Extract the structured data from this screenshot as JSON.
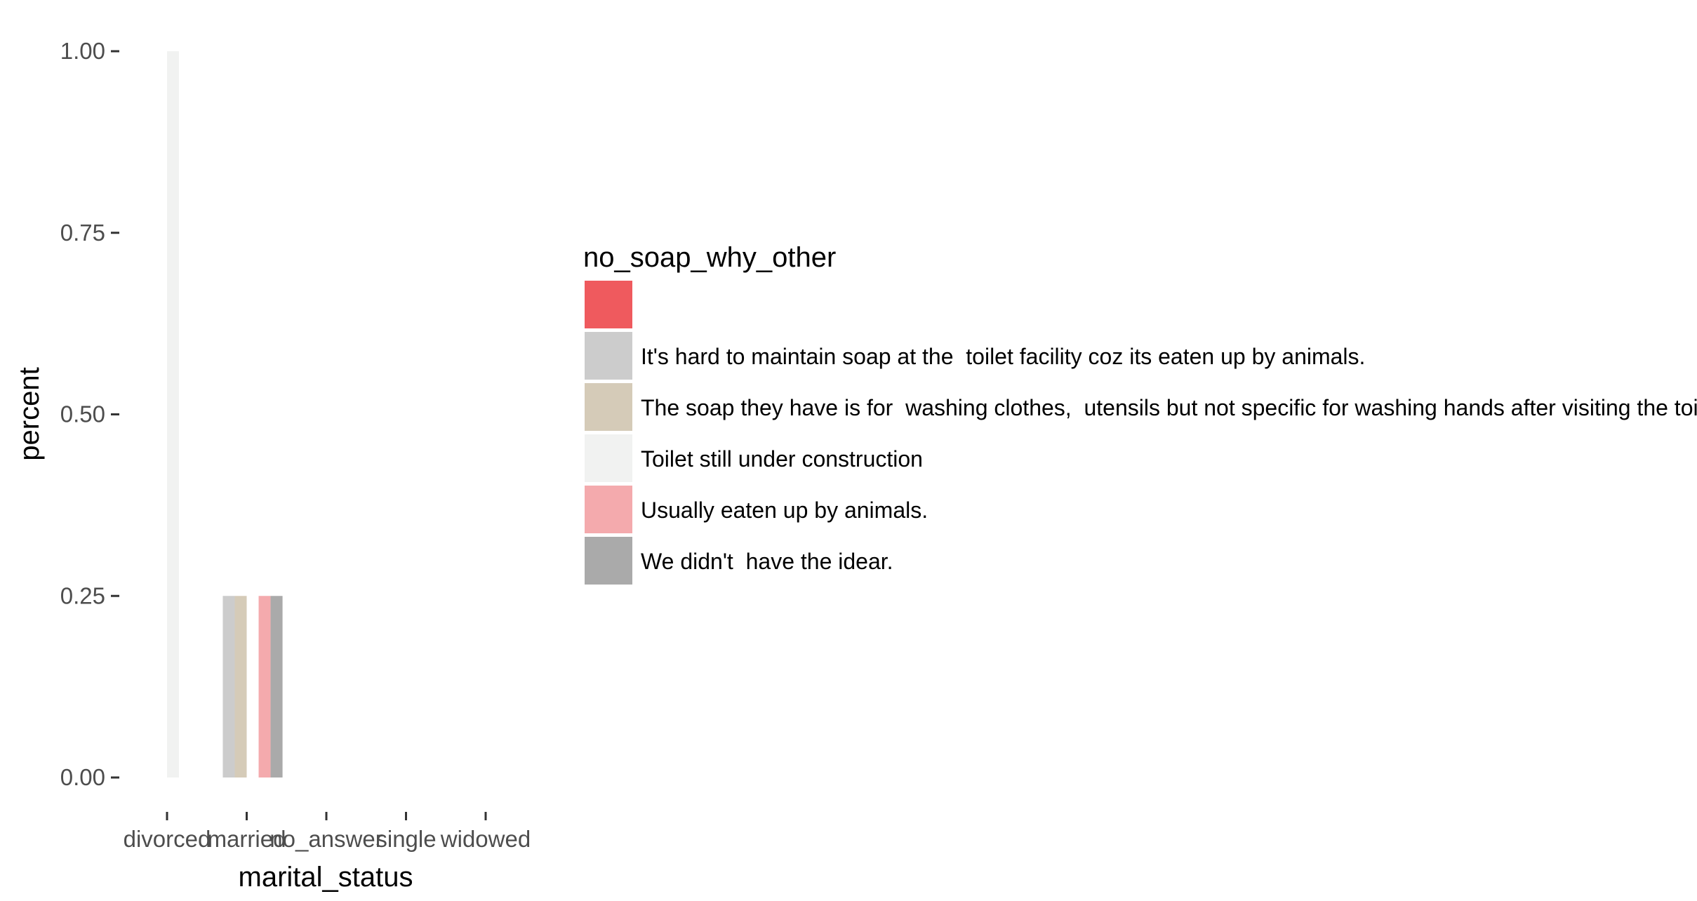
{
  "chart_data": {
    "type": "bar",
    "xlabel": "marital_status",
    "ylabel": "percent",
    "categories": [
      "divorced",
      "married",
      "no_answer",
      "single",
      "widowed"
    ],
    "ylim": [
      0,
      1
    ],
    "y_ticks": [
      "0.00",
      "0.25",
      "0.50",
      "0.75",
      "1.00"
    ],
    "y_tick_values": [
      0,
      0.25,
      0.5,
      0.75,
      1
    ],
    "grid": false,
    "legend": {
      "title": "no_soap_why_other",
      "placement": "right"
    },
    "series": [
      {
        "name": "",
        "color": "#ef5a5e",
        "values": [
          0,
          0,
          0,
          0,
          0
        ]
      },
      {
        "name": "It's hard to maintain soap at the  toilet facility coz its eaten up by animals.",
        "color": "#cccccc",
        "values": [
          0,
          0.25,
          0,
          0,
          0
        ]
      },
      {
        "name": "The soap they have is for  washing clothes,  utensils but not specific for washing hands after visiting the toilet.",
        "color": "#d5cbb8",
        "values": [
          0,
          0.25,
          0,
          0,
          0
        ]
      },
      {
        "name": "Toilet still under construction",
        "color": "#f1f2f1",
        "values": [
          1,
          0,
          0,
          0,
          0
        ]
      },
      {
        "name": "Usually eaten up by animals.",
        "color": "#f4aaad",
        "values": [
          0,
          0.25,
          0,
          0,
          0
        ]
      },
      {
        "name": "We didn't  have the idear.",
        "color": "#aaaaaa",
        "values": [
          0,
          0.25,
          0,
          0,
          0
        ]
      }
    ]
  }
}
